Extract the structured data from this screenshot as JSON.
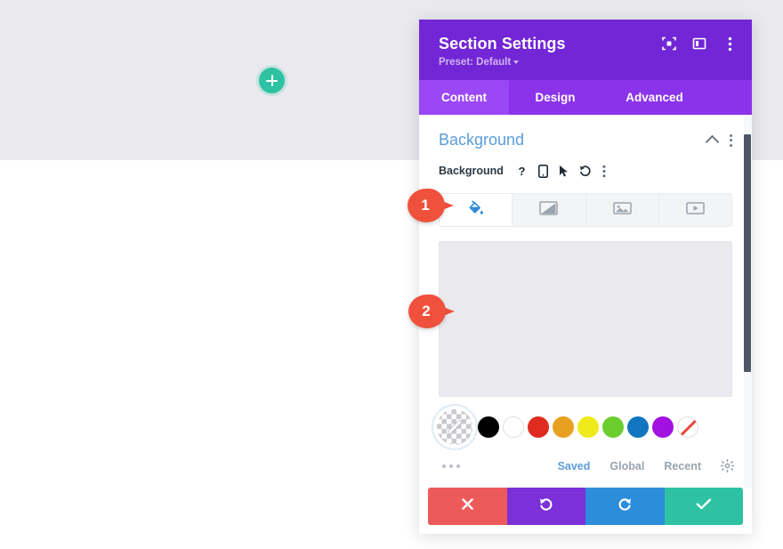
{
  "canvas": {
    "add_section_button_label": "+",
    "add_section_icon": "plus-icon"
  },
  "panel": {
    "title": "Section Settings",
    "preset_label": "Preset: Default",
    "header_icons": [
      {
        "name": "focus-icon",
        "label": "Focus"
      },
      {
        "name": "layout-icon",
        "label": "Layout"
      },
      {
        "name": "more-vertical-icon",
        "label": "More options"
      }
    ],
    "tabs": [
      {
        "label": "Content",
        "active": true
      },
      {
        "label": "Design",
        "active": false
      },
      {
        "label": "Advanced",
        "active": false
      }
    ],
    "section": {
      "title": "Background",
      "collapse_icon": "chevron-up-icon",
      "menu_icon": "more-vertical-icon"
    },
    "field": {
      "label": "Background",
      "icons": [
        {
          "name": "help-icon",
          "glyph": "?"
        },
        {
          "name": "responsive-mobile-icon",
          "glyph": "mobile"
        },
        {
          "name": "hover-cursor-icon",
          "glyph": "cursor"
        },
        {
          "name": "reset-undo-icon",
          "glyph": "undo"
        },
        {
          "name": "more-vertical-icon",
          "glyph": "dots"
        }
      ]
    },
    "background_types": [
      {
        "name": "background-color-tab",
        "icon": "paint-bucket-icon",
        "active": true
      },
      {
        "name": "background-gradient-tab",
        "icon": "gradient-icon",
        "active": false
      },
      {
        "name": "background-image-tab",
        "icon": "image-icon",
        "active": false
      },
      {
        "name": "background-video-tab",
        "icon": "video-icon",
        "active": false
      }
    ],
    "color_preview": {
      "name": "color-preview-area",
      "color": "#eaeaee"
    },
    "swatches": [
      {
        "name": "transparent-eyedropper-swatch",
        "color": "transparent",
        "selected": true
      },
      {
        "name": "swatch-black",
        "color": "#000000"
      },
      {
        "name": "swatch-white",
        "color": "#ffffff"
      },
      {
        "name": "swatch-red",
        "color": "#e02b20"
      },
      {
        "name": "swatch-orange",
        "color": "#e8a020"
      },
      {
        "name": "swatch-yellow",
        "color": "#eeea1c"
      },
      {
        "name": "swatch-green",
        "color": "#6cce2e"
      },
      {
        "name": "swatch-blue",
        "color": "#1275c0"
      },
      {
        "name": "swatch-purple",
        "color": "#a211e0"
      },
      {
        "name": "swatch-none",
        "color": "none"
      }
    ],
    "palette_footer": {
      "more_icon": "more-horizontal-icon",
      "links": [
        {
          "label": "Saved",
          "active": true
        },
        {
          "label": "Global",
          "active": false
        },
        {
          "label": "Recent",
          "active": false
        }
      ],
      "settings_icon": "gear-icon"
    },
    "footer_buttons": [
      {
        "name": "cancel-button",
        "icon": "close-icon",
        "color": "#ec5a5a"
      },
      {
        "name": "undo-button",
        "icon": "undo-icon",
        "color": "#7b30d8"
      },
      {
        "name": "redo-button",
        "icon": "redo-icon",
        "color": "#2c8ddb"
      },
      {
        "name": "save-button",
        "icon": "check-icon",
        "color": "#2ec2a3"
      }
    ],
    "scrollbar": {
      "name": "panel-scrollbar",
      "color": "#4c5665"
    }
  },
  "callouts": [
    {
      "number": "1",
      "target": "background-color-tab"
    },
    {
      "number": "2",
      "target": "color-preview-area"
    }
  ],
  "colors": {
    "header_purple": "#7226d6",
    "tabs_purple": "#8b33ea",
    "active_tab_purple": "#9a47f5",
    "section_title_blue": "#5b9dd9",
    "callout_red": "#f0513c",
    "accent_teal": "#2ec2a3"
  }
}
